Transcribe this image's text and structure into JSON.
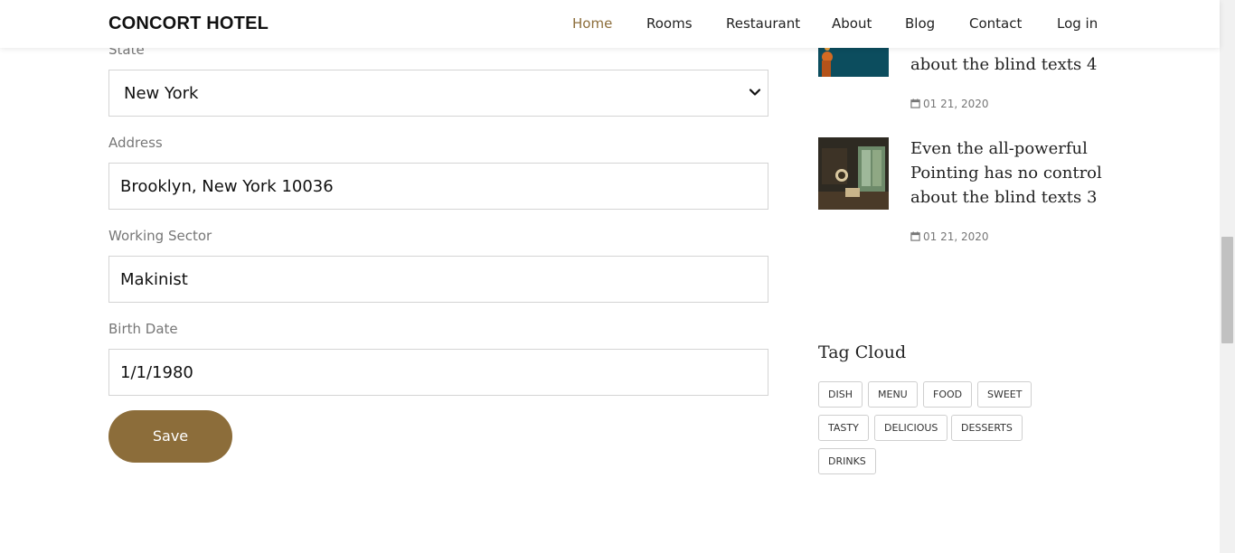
{
  "navbar": {
    "brand": "CONCORT HOTEL",
    "items": [
      {
        "label": "Home",
        "active": true
      },
      {
        "label": "Rooms"
      },
      {
        "label": "Restaurant"
      },
      {
        "label": "About"
      },
      {
        "label": "Blog"
      },
      {
        "label": "Contact"
      },
      {
        "label": "Log in"
      }
    ]
  },
  "form": {
    "state": {
      "label": "State",
      "value": "New York"
    },
    "address": {
      "label": "Address",
      "value": "Brooklyn, New York 10036"
    },
    "working_sector": {
      "label": "Working Sector",
      "value": "Makinist"
    },
    "birth_date": {
      "label": "Birth Date",
      "value": "1/1/1980"
    },
    "save_label": "Save"
  },
  "sidebar": {
    "posts": [
      {
        "title_partial": "about the blind texts 4",
        "date": "01 21, 2020"
      },
      {
        "title": "Even the all-powerful Pointing has no control about the blind texts 3",
        "date": "01 21, 2020"
      }
    ],
    "tag_cloud": {
      "heading": "Tag Cloud",
      "tags": [
        "DISH",
        "MENU",
        "FOOD",
        "SWEET",
        "TASTY",
        "DELICIOUS",
        "DESSERTS",
        "DRINKS"
      ]
    }
  },
  "colors": {
    "accent": "#8c6d3a",
    "border": "#d4d4d4",
    "label": "#777777"
  },
  "icons": {
    "date": "calendar-icon",
    "select": "chevron-down-icon"
  }
}
